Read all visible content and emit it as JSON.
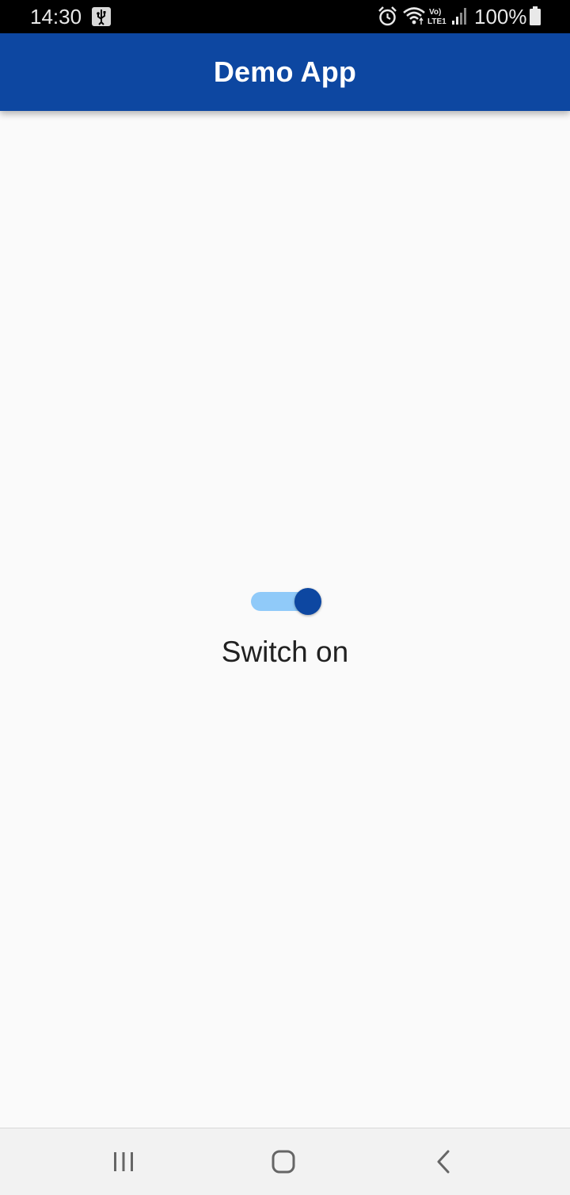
{
  "status_bar": {
    "time": "14:30",
    "battery_percent": "100%",
    "network_label": "Vo) LTE1",
    "icons": [
      "usb-icon",
      "alarm-icon",
      "wifi-icon",
      "lte-icon",
      "signal-icon",
      "battery-icon"
    ]
  },
  "app_bar": {
    "title": "Demo App",
    "color": "#0d47a1"
  },
  "switch": {
    "checked": true,
    "label": "Switch on",
    "track_color": "#90caf9",
    "thumb_color": "#0d47a1"
  },
  "nav_bar": {
    "icons": [
      "recents-icon",
      "home-icon",
      "back-icon"
    ]
  }
}
